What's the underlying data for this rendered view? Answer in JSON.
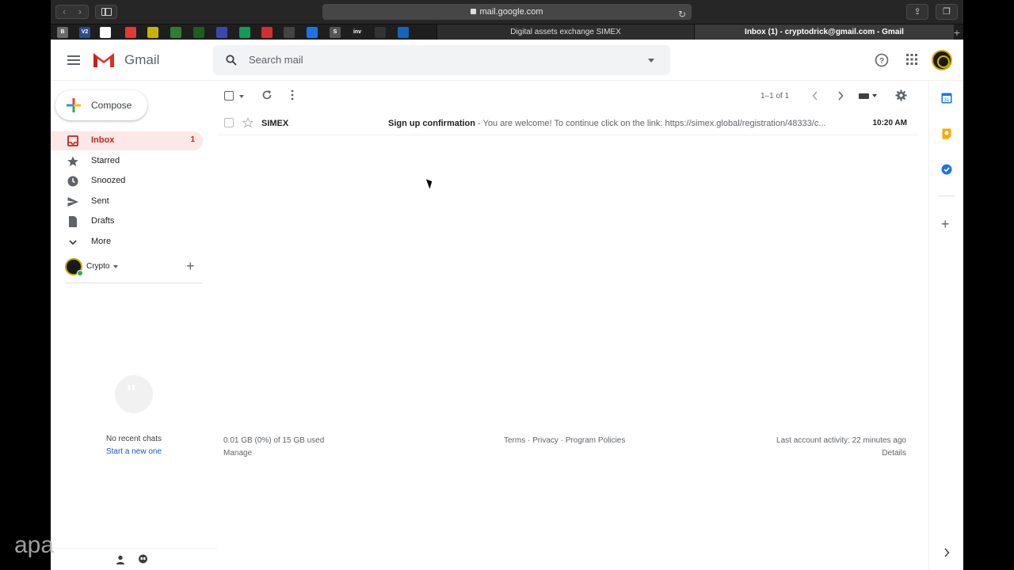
{
  "browser": {
    "address": "mail.google.com",
    "tabs": [
      {
        "title": "Digital assets exchange SIMEX"
      },
      {
        "title": "Inbox (1) - cryptodrick@gmail.com - Gmail"
      }
    ],
    "favicons": [
      {
        "label": "B",
        "color": "#6b6b6b"
      },
      {
        "label": "V2",
        "color": "#2b4d8a"
      },
      {
        "label": "",
        "color": "#ffffff"
      },
      {
        "label": "",
        "color": "#e53935"
      },
      {
        "label": "",
        "color": "#c8b400"
      },
      {
        "label": "",
        "color": "#2e7d32"
      },
      {
        "label": "",
        "color": "#1b5e20"
      },
      {
        "label": "",
        "color": "#3949ab"
      },
      {
        "label": "",
        "color": "#0f9d58"
      },
      {
        "label": "",
        "color": "#d32f2f"
      },
      {
        "label": "",
        "color": "#444444"
      },
      {
        "label": "",
        "color": "#1a73e8"
      },
      {
        "label": "S",
        "color": "#555555"
      },
      {
        "label": "inv",
        "color": "#222222"
      },
      {
        "label": "",
        "color": "#333333"
      },
      {
        "label": "",
        "color": "#1565c0"
      }
    ]
  },
  "gmail": {
    "logo_text": "Gmail",
    "search_placeholder": "Search mail",
    "compose_label": "Compose",
    "nav": [
      {
        "label": "Inbox",
        "count": "1",
        "icon": "inbox-icon"
      },
      {
        "label": "Starred",
        "count": "",
        "icon": "star-icon"
      },
      {
        "label": "Snoozed",
        "count": "",
        "icon": "clock-icon"
      },
      {
        "label": "Sent",
        "count": "",
        "icon": "send-icon"
      },
      {
        "label": "Drafts",
        "count": "",
        "icon": "draft-icon"
      },
      {
        "label": "More",
        "count": "",
        "icon": "chevron-down-icon"
      }
    ],
    "hangouts_user": "Crypto",
    "no_chats": "No recent chats",
    "start_new": "Start a new one",
    "pager": "1–1 of 1",
    "emails": [
      {
        "sender": "SIMEX",
        "subject": "Sign up confirmation",
        "snippet": " - You are welcome! To continue click on the link: https://simex.global/registration/48333/c...",
        "time": "10:20 AM"
      }
    ],
    "footer": {
      "storage": "0.01 GB (0%) of 15 GB used",
      "manage": "Manage",
      "links": "Terms · Privacy · Program Policies",
      "activity": "Last account activity: 22 minutes ago",
      "details": "Details"
    },
    "colors": {
      "accent_red": "#c5221f",
      "active_bg": "#fce8e6",
      "link_blue": "#1a57b8"
    }
  },
  "watermark": "apa"
}
